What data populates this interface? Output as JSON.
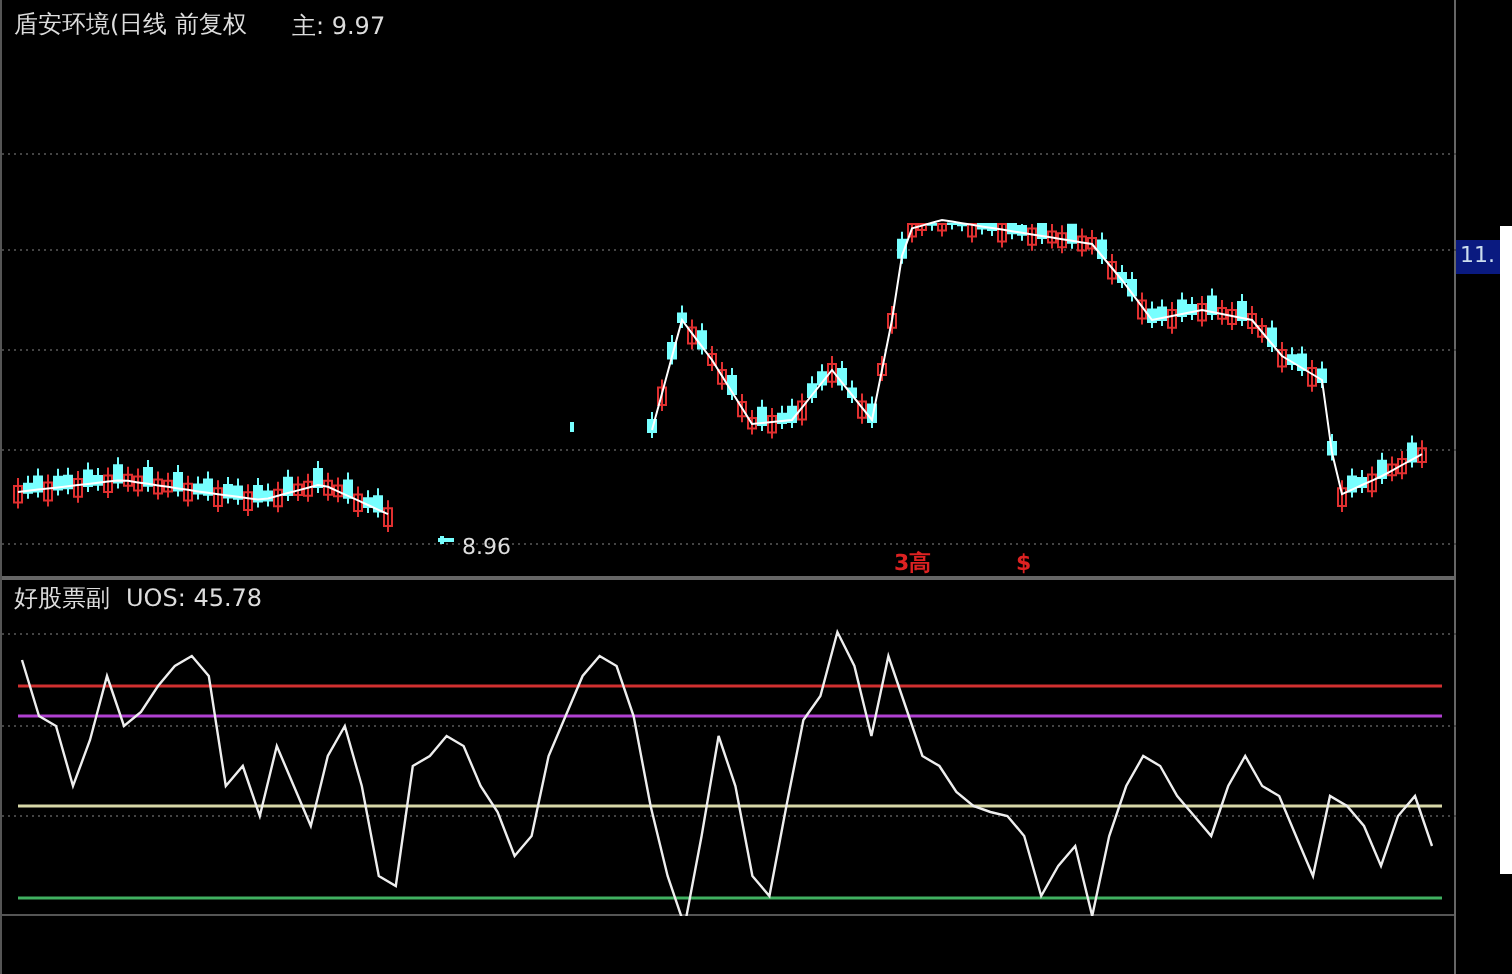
{
  "main_chart": {
    "title": "盾安环境(日线 前复权",
    "main_label": "主: 9.97",
    "axis_label": "11.",
    "low_label": "8.96",
    "markers": [
      {
        "text": "3高"
      },
      {
        "text": "$"
      }
    ]
  },
  "indicator": {
    "title": "好股票副",
    "reading": "UOS: 45.78"
  }
}
